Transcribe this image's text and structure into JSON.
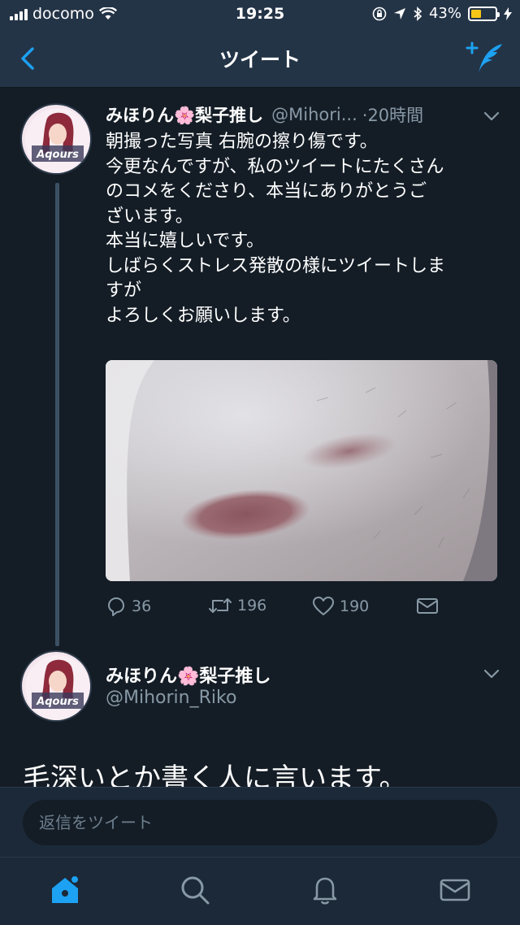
{
  "status_bar": {
    "carrier": "docomo",
    "time": "19:25",
    "battery": "43%",
    "battery_level": 0.43
  },
  "nav": {
    "title": "ツイート"
  },
  "tweet": {
    "display_name": "みほりん🌸梨子推し",
    "handle": "@Mihori...",
    "time": "·20時間",
    "lines": [
      "朝撮った写真 右腕の擦り傷です。",
      "今更なんですが、私のツイートにたくさん",
      "のコメをくださり、本当にありがとうご",
      "ざいます。",
      "本当に嬉しいです。",
      "しばらくストレス発散の様にツイートしま",
      "すが",
      "よろしくお願いします。"
    ],
    "avatar_text": "Aqours",
    "replies": "36",
    "retweets": "196",
    "likes": "190"
  },
  "reply_tweet": {
    "display_name": "みほりん🌸梨子推し",
    "handle": "@Mihorin_Riko",
    "text": "毛深いとか書く人に言います。"
  },
  "reply_bar": {
    "placeholder": "返信をツイート"
  },
  "colors": {
    "background": "#141d26",
    "header": "#243447",
    "accent": "#1da1f2",
    "muted": "#8899a6"
  }
}
